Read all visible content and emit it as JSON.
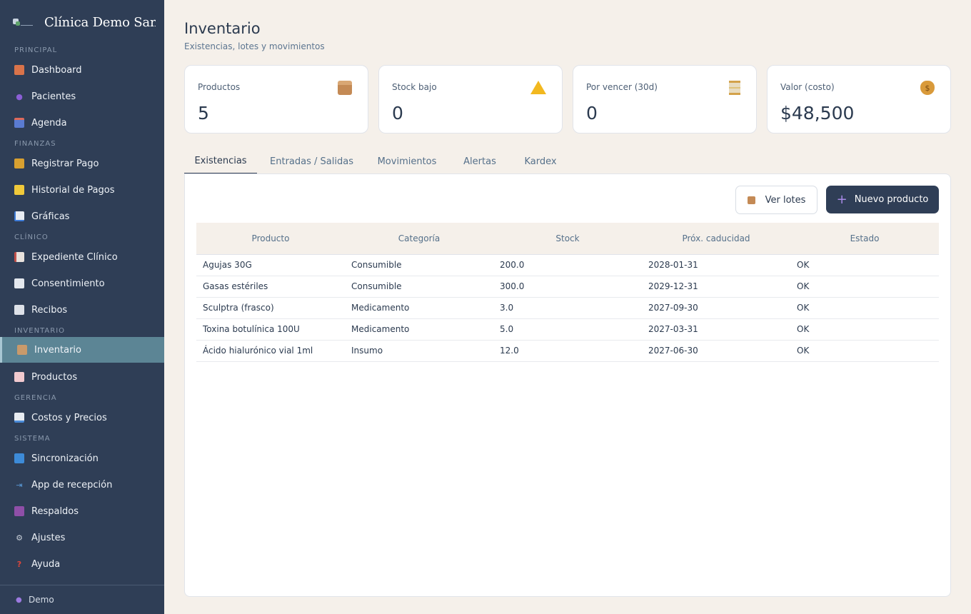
{
  "brand": {
    "name": "Clínica Demo Santo"
  },
  "sidebar": {
    "sections": {
      "principal": "PRINCIPAL",
      "finanzas": "FINANZAS",
      "clinico": "CLÍNICO",
      "inventario": "INVENTARIO",
      "gerencia": "GERENCIA",
      "sistema": "SISTEMA"
    },
    "items": [
      {
        "label": "Dashboard",
        "icon": "house-icon"
      },
      {
        "label": "Pacientes",
        "icon": "people-icon"
      },
      {
        "label": "Agenda",
        "icon": "calendar-icon"
      },
      {
        "label": "Registrar Pago",
        "icon": "money-bag-icon"
      },
      {
        "label": "Historial de Pagos",
        "icon": "note-icon"
      },
      {
        "label": "Gráficas",
        "icon": "chart-icon"
      },
      {
        "label": "Expediente Clínico",
        "icon": "clipboard-icon"
      },
      {
        "label": "Consentimiento",
        "icon": "document-icon"
      },
      {
        "label": "Recibos",
        "icon": "receipt-icon"
      },
      {
        "label": "Inventario",
        "icon": "box-icon"
      },
      {
        "label": "Productos",
        "icon": "bottle-icon"
      },
      {
        "label": "Costos y Precios",
        "icon": "bar-chart-icon"
      },
      {
        "label": "Sincronización",
        "icon": "sync-icon"
      },
      {
        "label": "App de recepción",
        "icon": "door-icon"
      },
      {
        "label": "Respaldos",
        "icon": "floppy-icon"
      },
      {
        "label": "Ajustes",
        "icon": "gear-icon"
      },
      {
        "label": "Ayuda",
        "icon": "question-icon"
      }
    ],
    "user": "Demo"
  },
  "header": {
    "title": "Inventario",
    "subtitle": "Existencias, lotes y movimientos"
  },
  "cards": [
    {
      "label": "Productos",
      "value": "5",
      "icon": "box-icon"
    },
    {
      "label": "Stock bajo",
      "value": "0",
      "icon": "warning-icon"
    },
    {
      "label": "Por vencer (30d)",
      "value": "0",
      "icon": "hourglass-icon"
    },
    {
      "label": "Valor (costo)",
      "value": "$48,500",
      "icon": "money-bag-icon"
    }
  ],
  "tabs": [
    "Existencias",
    "Entradas / Salidas",
    "Movimientos",
    "Alertas",
    "Kardex"
  ],
  "actions": {
    "ver_lotes": "Ver lotes",
    "nuevo_producto": "Nuevo producto"
  },
  "table": {
    "headers": [
      "Producto",
      "Categoría",
      "Stock",
      "Próx. caducidad",
      "Estado"
    ],
    "rows": [
      [
        "Agujas 30G",
        "Consumible",
        "200.0",
        "2028-01-31",
        "OK"
      ],
      [
        "Gasas estériles",
        "Consumible",
        "300.0",
        "2029-12-31",
        "OK"
      ],
      [
        "Sculptra (frasco)",
        "Medicamento",
        "3.0",
        "2027-09-30",
        "OK"
      ],
      [
        "Toxina botulínica 100U",
        "Medicamento",
        "5.0",
        "2027-03-31",
        "OK"
      ],
      [
        "Ácido hialurónico vial 1ml",
        "Insumo",
        "12.0",
        "2027-06-30",
        "OK"
      ]
    ]
  }
}
